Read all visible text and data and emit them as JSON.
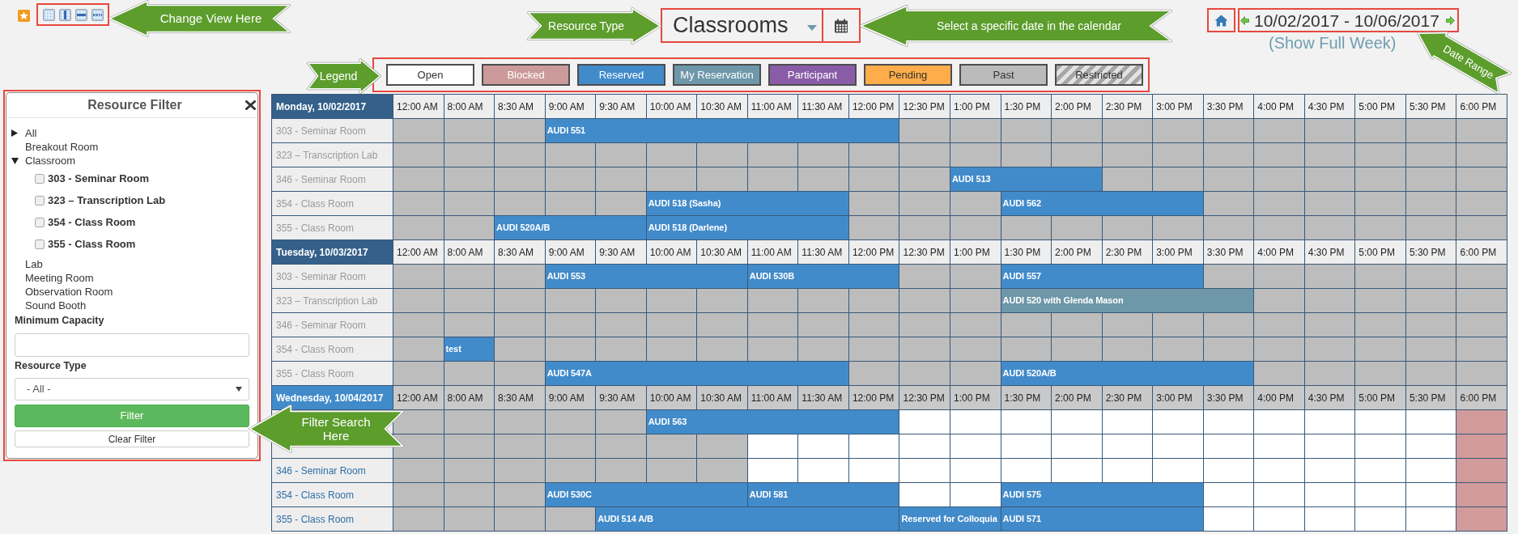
{
  "callouts": {
    "change_view": "Change View Here",
    "resource_type": "Resource Type",
    "select_date": "Select a specific date in the calendar",
    "date_range": "Date Range",
    "legend": "Legend",
    "filter_search": "Filter Search Here"
  },
  "resource_type": {
    "value": "Classrooms"
  },
  "date_range": {
    "text": "10/02/2017 - 10/06/2017",
    "link": "(Show Full Week)"
  },
  "legend": [
    {
      "label": "Open",
      "color": "#ffffff",
      "striped": false
    },
    {
      "label": "Blocked",
      "color": "#cc9a9a",
      "striped": false
    },
    {
      "label": "Reserved",
      "color": "#428bca",
      "striped": false
    },
    {
      "label": "My Reservation",
      "color": "#6e98aa",
      "striped": false
    },
    {
      "label": "Participant",
      "color": "#8a5ca8",
      "striped": false
    },
    {
      "label": "Pending",
      "color": "#ffad4a",
      "striped": false
    },
    {
      "label": "Past",
      "color": "#bbbbbb",
      "striped": false
    },
    {
      "label": "Restricted",
      "color": "#a6a6a6",
      "striped": true
    }
  ],
  "filter_panel": {
    "title": "Resource Filter",
    "tree": [
      {
        "label": "All",
        "expanded": false
      },
      {
        "label": "Breakout Room"
      },
      {
        "label": "Classroom",
        "expanded": true,
        "children": [
          {
            "label": "303 - Seminar Room",
            "checked": false
          },
          {
            "label": "323 – Transcription Lab",
            "checked": false
          },
          {
            "label": "354 - Class Room",
            "checked": false
          },
          {
            "label": "355 - Class Room",
            "checked": false
          }
        ]
      },
      {
        "label": "Lab"
      },
      {
        "label": "Meeting Room"
      },
      {
        "label": "Observation Room"
      },
      {
        "label": "Sound Booth"
      }
    ],
    "capacity": {
      "label": "Minimum Capacity"
    },
    "type_filter": {
      "label": "Resource Type",
      "value": "- All -"
    },
    "buttons": [
      {
        "label": "Filter",
        "kind": "primary"
      },
      {
        "label": "Clear Filter",
        "kind": "secondary"
      }
    ]
  },
  "schedule": {
    "days": [
      {
        "label": "Monday, 10/02/2017",
        "past": true,
        "times": [
          "12:00 AM",
          "8:00 AM",
          "8:30 AM",
          "9:00 AM",
          "9:30 AM",
          "10:00 AM",
          "10:30 AM",
          "11:00 AM",
          "11:30 AM",
          "12:00 PM",
          "12:30 PM",
          "1:00 PM",
          "1:30 PM",
          "2:00 PM",
          "2:30 PM",
          "3:00 PM",
          "3:30 PM",
          "4:00 PM",
          "4:30 PM",
          "5:00 PM",
          "5:30 PM",
          "6:00 PM"
        ],
        "rows": [
          {
            "room": "303 - Seminar Room",
            "cells": [
              {
                "kind": "slot",
                "color": "#bdbdbd"
              },
              {
                "kind": "slot",
                "color": "#bdbdbd"
              },
              {
                "kind": "slot",
                "color": "#bdbdbd"
              },
              {
                "kind": "booking",
                "color": "#428bca",
                "label": "AUDI 551"
              },
              {
                "kind": "continued"
              },
              {
                "kind": "continued"
              },
              {
                "kind": "continued"
              },
              {
                "kind": "continued"
              },
              {
                "kind": "continued"
              },
              {
                "kind": "continued"
              },
              {
                "kind": "slot",
                "color": "#bdbdbd"
              },
              {
                "kind": "slot",
                "color": "#bdbdbd"
              },
              {
                "kind": "slot",
                "color": "#bdbdbd"
              },
              {
                "kind": "slot",
                "color": "#bdbdbd"
              },
              {
                "kind": "slot",
                "color": "#bdbdbd"
              },
              {
                "kind": "slot",
                "color": "#bdbdbd"
              },
              {
                "kind": "slot",
                "color": "#bdbdbd"
              },
              {
                "kind": "slot",
                "color": "#bdbdbd"
              },
              {
                "kind": "slot",
                "color": "#bdbdbd"
              },
              {
                "kind": "slot",
                "color": "#bdbdbd"
              },
              {
                "kind": "slot",
                "color": "#bdbdbd"
              },
              {
                "kind": "slot",
                "color": "#bdbdbd"
              }
            ]
          },
          {
            "room": "323 – Transcription Lab",
            "cells": [
              {
                "kind": "slot",
                "color": "#bdbdbd"
              },
              {
                "kind": "slot",
                "color": "#bdbdbd"
              },
              {
                "kind": "slot",
                "color": "#bdbdbd"
              },
              {
                "kind": "slot",
                "color": "#bdbdbd"
              },
              {
                "kind": "slot",
                "color": "#bdbdbd"
              },
              {
                "kind": "slot",
                "color": "#bdbdbd"
              },
              {
                "kind": "slot",
                "color": "#bdbdbd"
              },
              {
                "kind": "slot",
                "color": "#bdbdbd"
              },
              {
                "kind": "slot",
                "color": "#bdbdbd"
              },
              {
                "kind": "slot",
                "color": "#bdbdbd"
              },
              {
                "kind": "slot",
                "color": "#bdbdbd"
              },
              {
                "kind": "slot",
                "color": "#bdbdbd"
              },
              {
                "kind": "slot",
                "color": "#bdbdbd"
              },
              {
                "kind": "slot",
                "color": "#bdbdbd"
              },
              {
                "kind": "slot",
                "color": "#bdbdbd"
              },
              {
                "kind": "slot",
                "color": "#bdbdbd"
              },
              {
                "kind": "slot",
                "color": "#bdbdbd"
              },
              {
                "kind": "slot",
                "color": "#bdbdbd"
              },
              {
                "kind": "slot",
                "color": "#bdbdbd"
              },
              {
                "kind": "slot",
                "color": "#bdbdbd"
              },
              {
                "kind": "slot",
                "color": "#bdbdbd"
              },
              {
                "kind": "slot",
                "color": "#bdbdbd"
              }
            ]
          },
          {
            "room": "346 - Seminar Room",
            "cells": [
              {
                "kind": "slot",
                "color": "#bdbdbd"
              },
              {
                "kind": "slot",
                "color": "#bdbdbd"
              },
              {
                "kind": "slot",
                "color": "#bdbdbd"
              },
              {
                "kind": "slot",
                "color": "#bdbdbd"
              },
              {
                "kind": "slot",
                "color": "#bdbdbd"
              },
              {
                "kind": "slot",
                "color": "#bdbdbd"
              },
              {
                "kind": "slot",
                "color": "#bdbdbd"
              },
              {
                "kind": "slot",
                "color": "#bdbdbd"
              },
              {
                "kind": "slot",
                "color": "#bdbdbd"
              },
              {
                "kind": "slot",
                "color": "#bdbdbd"
              },
              {
                "kind": "slot",
                "color": "#bdbdbd"
              },
              {
                "kind": "booking",
                "color": "#428bca",
                "label": "AUDI 513"
              },
              {
                "kind": "continued"
              },
              {
                "kind": "continued"
              },
              {
                "kind": "slot",
                "color": "#bdbdbd"
              },
              {
                "kind": "slot",
                "color": "#bdbdbd"
              },
              {
                "kind": "slot",
                "color": "#bdbdbd"
              },
              {
                "kind": "slot",
                "color": "#bdbdbd"
              },
              {
                "kind": "slot",
                "color": "#bdbdbd"
              },
              {
                "kind": "slot",
                "color": "#bdbdbd"
              },
              {
                "kind": "slot",
                "color": "#bdbdbd"
              },
              {
                "kind": "slot",
                "color": "#bdbdbd"
              }
            ]
          },
          {
            "room": "354 - Class Room",
            "cells": [
              {
                "kind": "slot",
                "color": "#bdbdbd"
              },
              {
                "kind": "slot",
                "color": "#bdbdbd"
              },
              {
                "kind": "slot",
                "color": "#bdbdbd"
              },
              {
                "kind": "slot",
                "color": "#bdbdbd"
              },
              {
                "kind": "slot",
                "color": "#bdbdbd"
              },
              {
                "kind": "booking",
                "color": "#428bca",
                "label": "AUDI 518 (Sasha)"
              },
              {
                "kind": "continued"
              },
              {
                "kind": "continued"
              },
              {
                "kind": "continued"
              },
              {
                "kind": "slot",
                "color": "#bdbdbd"
              },
              {
                "kind": "slot",
                "color": "#bdbdbd"
              },
              {
                "kind": "slot",
                "color": "#bdbdbd"
              },
              {
                "kind": "booking",
                "color": "#428bca",
                "label": "AUDI 562"
              },
              {
                "kind": "continued"
              },
              {
                "kind": "continued"
              },
              {
                "kind": "continued"
              },
              {
                "kind": "slot",
                "color": "#bdbdbd"
              },
              {
                "kind": "slot",
                "color": "#bdbdbd"
              },
              {
                "kind": "slot",
                "color": "#bdbdbd"
              },
              {
                "kind": "slot",
                "color": "#bdbdbd"
              },
              {
                "kind": "slot",
                "color": "#bdbdbd"
              },
              {
                "kind": "slot",
                "color": "#bdbdbd"
              }
            ]
          },
          {
            "room": "355 - Class Room",
            "cells": [
              {
                "kind": "slot",
                "color": "#bdbdbd"
              },
              {
                "kind": "slot",
                "color": "#bdbdbd"
              },
              {
                "kind": "booking",
                "color": "#428bca",
                "label": "AUDI 520A/B"
              },
              {
                "kind": "continued"
              },
              {
                "kind": "continued"
              },
              {
                "kind": "booking",
                "color": "#428bca",
                "label": "AUDI 518 (Darlene)"
              },
              {
                "kind": "continued"
              },
              {
                "kind": "continued"
              },
              {
                "kind": "continued"
              },
              {
                "kind": "slot",
                "color": "#bdbdbd"
              },
              {
                "kind": "slot",
                "color": "#bdbdbd"
              },
              {
                "kind": "slot",
                "color": "#bdbdbd"
              },
              {
                "kind": "slot",
                "color": "#bdbdbd"
              },
              {
                "kind": "slot",
                "color": "#bdbdbd"
              },
              {
                "kind": "slot",
                "color": "#bdbdbd"
              },
              {
                "kind": "slot",
                "color": "#bdbdbd"
              },
              {
                "kind": "slot",
                "color": "#bdbdbd"
              },
              {
                "kind": "slot",
                "color": "#bdbdbd"
              },
              {
                "kind": "slot",
                "color": "#bdbdbd"
              },
              {
                "kind": "slot",
                "color": "#bdbdbd"
              },
              {
                "kind": "slot",
                "color": "#bdbdbd"
              },
              {
                "kind": "slot",
                "color": "#bdbdbd"
              }
            ]
          }
        ]
      },
      {
        "label": "Tuesday, 10/03/2017",
        "past": true,
        "times": [
          "12:00 AM",
          "8:00 AM",
          "8:30 AM",
          "9:00 AM",
          "9:30 AM",
          "10:00 AM",
          "10:30 AM",
          "11:00 AM",
          "11:30 AM",
          "12:00 PM",
          "12:30 PM",
          "1:00 PM",
          "1:30 PM",
          "2:00 PM",
          "2:30 PM",
          "3:00 PM",
          "3:30 PM",
          "4:00 PM",
          "4:30 PM",
          "5:00 PM",
          "5:30 PM",
          "6:00 PM"
        ],
        "rows": [
          {
            "room": "303 - Seminar Room",
            "cells": [
              {
                "kind": "slot",
                "color": "#bdbdbd"
              },
              {
                "kind": "slot",
                "color": "#bdbdbd"
              },
              {
                "kind": "slot",
                "color": "#bdbdbd"
              },
              {
                "kind": "booking",
                "color": "#428bca",
                "label": "AUDI 553"
              },
              {
                "kind": "continued"
              },
              {
                "kind": "continued"
              },
              {
                "kind": "continued"
              },
              {
                "kind": "booking",
                "color": "#428bca",
                "label": "AUDI 530B"
              },
              {
                "kind": "continued"
              },
              {
                "kind": "continued"
              },
              {
                "kind": "slot",
                "color": "#bdbdbd"
              },
              {
                "kind": "slot",
                "color": "#bdbdbd"
              },
              {
                "kind": "booking",
                "color": "#428bca",
                "label": "AUDI 557"
              },
              {
                "kind": "continued"
              },
              {
                "kind": "continued"
              },
              {
                "kind": "continued"
              },
              {
                "kind": "slot",
                "color": "#bdbdbd"
              },
              {
                "kind": "slot",
                "color": "#bdbdbd"
              },
              {
                "kind": "slot",
                "color": "#bdbdbd"
              },
              {
                "kind": "slot",
                "color": "#bdbdbd"
              },
              {
                "kind": "slot",
                "color": "#bdbdbd"
              },
              {
                "kind": "slot",
                "color": "#bdbdbd"
              }
            ]
          },
          {
            "room": "323 – Transcription Lab",
            "cells": [
              {
                "kind": "slot",
                "color": "#bdbdbd"
              },
              {
                "kind": "slot",
                "color": "#bdbdbd"
              },
              {
                "kind": "slot",
                "color": "#bdbdbd"
              },
              {
                "kind": "slot",
                "color": "#bdbdbd"
              },
              {
                "kind": "slot",
                "color": "#bdbdbd"
              },
              {
                "kind": "slot",
                "color": "#bdbdbd"
              },
              {
                "kind": "slot",
                "color": "#bdbdbd"
              },
              {
                "kind": "slot",
                "color": "#bdbdbd"
              },
              {
                "kind": "slot",
                "color": "#bdbdbd"
              },
              {
                "kind": "slot",
                "color": "#bdbdbd"
              },
              {
                "kind": "slot",
                "color": "#bdbdbd"
              },
              {
                "kind": "slot",
                "color": "#bdbdbd"
              },
              {
                "kind": "booking",
                "color": "#6e97a9",
                "label": "AUDI 520 with Glenda Mason"
              },
              {
                "kind": "continued"
              },
              {
                "kind": "continued"
              },
              {
                "kind": "continued"
              },
              {
                "kind": "continued"
              },
              {
                "kind": "slot",
                "color": "#bdbdbd"
              },
              {
                "kind": "slot",
                "color": "#bdbdbd"
              },
              {
                "kind": "slot",
                "color": "#bdbdbd"
              },
              {
                "kind": "slot",
                "color": "#bdbdbd"
              },
              {
                "kind": "slot",
                "color": "#bdbdbd"
              }
            ]
          },
          {
            "room": "346 - Seminar Room",
            "cells": [
              {
                "kind": "slot",
                "color": "#bdbdbd"
              },
              {
                "kind": "slot",
                "color": "#bdbdbd"
              },
              {
                "kind": "slot",
                "color": "#bdbdbd"
              },
              {
                "kind": "slot",
                "color": "#bdbdbd"
              },
              {
                "kind": "slot",
                "color": "#bdbdbd"
              },
              {
                "kind": "slot",
                "color": "#bdbdbd"
              },
              {
                "kind": "slot",
                "color": "#bdbdbd"
              },
              {
                "kind": "slot",
                "color": "#bdbdbd"
              },
              {
                "kind": "slot",
                "color": "#bdbdbd"
              },
              {
                "kind": "slot",
                "color": "#bdbdbd"
              },
              {
                "kind": "slot",
                "color": "#bdbdbd"
              },
              {
                "kind": "slot",
                "color": "#bdbdbd"
              },
              {
                "kind": "slot",
                "color": "#bdbdbd"
              },
              {
                "kind": "slot",
                "color": "#bdbdbd"
              },
              {
                "kind": "slot",
                "color": "#bdbdbd"
              },
              {
                "kind": "slot",
                "color": "#bdbdbd"
              },
              {
                "kind": "slot",
                "color": "#bdbdbd"
              },
              {
                "kind": "slot",
                "color": "#bdbdbd"
              },
              {
                "kind": "slot",
                "color": "#bdbdbd"
              },
              {
                "kind": "slot",
                "color": "#bdbdbd"
              },
              {
                "kind": "slot",
                "color": "#bdbdbd"
              },
              {
                "kind": "slot",
                "color": "#bdbdbd"
              }
            ]
          },
          {
            "room": "354 - Class Room",
            "cells": [
              {
                "kind": "slot",
                "color": "#bdbdbd"
              },
              {
                "kind": "booking",
                "color": "#428bca",
                "label": "test"
              },
              {
                "kind": "slot",
                "color": "#bdbdbd"
              },
              {
                "kind": "slot",
                "color": "#bdbdbd"
              },
              {
                "kind": "slot",
                "color": "#bdbdbd"
              },
              {
                "kind": "slot",
                "color": "#bdbdbd"
              },
              {
                "kind": "slot",
                "color": "#bdbdbd"
              },
              {
                "kind": "slot",
                "color": "#bdbdbd"
              },
              {
                "kind": "slot",
                "color": "#bdbdbd"
              },
              {
                "kind": "slot",
                "color": "#bdbdbd"
              },
              {
                "kind": "slot",
                "color": "#bdbdbd"
              },
              {
                "kind": "slot",
                "color": "#bdbdbd"
              },
              {
                "kind": "slot",
                "color": "#bdbdbd"
              },
              {
                "kind": "slot",
                "color": "#bdbdbd"
              },
              {
                "kind": "slot",
                "color": "#bdbdbd"
              },
              {
                "kind": "slot",
                "color": "#bdbdbd"
              },
              {
                "kind": "slot",
                "color": "#bdbdbd"
              },
              {
                "kind": "slot",
                "color": "#bdbdbd"
              },
              {
                "kind": "slot",
                "color": "#bdbdbd"
              },
              {
                "kind": "slot",
                "color": "#bdbdbd"
              },
              {
                "kind": "slot",
                "color": "#bdbdbd"
              },
              {
                "kind": "slot",
                "color": "#bdbdbd"
              }
            ]
          },
          {
            "room": "355 - Class Room",
            "cells": [
              {
                "kind": "slot",
                "color": "#bdbdbd"
              },
              {
                "kind": "slot",
                "color": "#bdbdbd"
              },
              {
                "kind": "slot",
                "color": "#bdbdbd"
              },
              {
                "kind": "booking",
                "color": "#428bca",
                "label": "AUDI 547A"
              },
              {
                "kind": "continued"
              },
              {
                "kind": "continued"
              },
              {
                "kind": "continued"
              },
              {
                "kind": "continued"
              },
              {
                "kind": "continued"
              },
              {
                "kind": "slot",
                "color": "#bdbdbd"
              },
              {
                "kind": "slot",
                "color": "#bdbdbd"
              },
              {
                "kind": "slot",
                "color": "#bdbdbd"
              },
              {
                "kind": "booking",
                "color": "#428bca",
                "label": "AUDI 520A/B"
              },
              {
                "kind": "continued"
              },
              {
                "kind": "continued"
              },
              {
                "kind": "continued"
              },
              {
                "kind": "continued"
              },
              {
                "kind": "slot",
                "color": "#bdbdbd"
              },
              {
                "kind": "slot",
                "color": "#bdbdbd"
              },
              {
                "kind": "slot",
                "color": "#bdbdbd"
              },
              {
                "kind": "slot",
                "color": "#bdbdbd"
              },
              {
                "kind": "slot",
                "color": "#bdbdbd"
              }
            ]
          }
        ]
      },
      {
        "label": "Wednesday, 10/04/2017",
        "past": false,
        "times": [
          "12:00 AM",
          "8:00 AM",
          "8:30 AM",
          "9:00 AM",
          "9:30 AM",
          "10:00 AM",
          "10:30 AM",
          "11:00 AM",
          "11:30 AM",
          "12:00 PM",
          "12:30 PM",
          "1:00 PM",
          "1:30 PM",
          "2:00 PM",
          "2:30 PM",
          "3:00 PM",
          "3:30 PM",
          "4:00 PM",
          "4:30 PM",
          "5:00 PM",
          "5:30 PM",
          "6:00 PM"
        ],
        "rows": [
          {
            "cells": [
              {
                "kind": "slot",
                "color": "#bdbdbd"
              },
              {
                "kind": "slot",
                "color": "#bdbdbd"
              },
              {
                "kind": "slot",
                "color": "#bdbdbd"
              },
              {
                "kind": "slot",
                "color": "#bdbdbd"
              },
              {
                "kind": "slot",
                "color": "#bdbdbd"
              },
              {
                "kind": "booking",
                "color": "#428bca",
                "label": "AUDI 563"
              },
              {
                "kind": "continued"
              },
              {
                "kind": "continued"
              },
              {
                "kind": "continued"
              },
              {
                "kind": "continued"
              },
              {
                "kind": "slot",
                "color": "#ffffff"
              },
              {
                "kind": "slot",
                "color": "#ffffff"
              },
              {
                "kind": "slot",
                "color": "#ffffff"
              },
              {
                "kind": "slot",
                "color": "#ffffff"
              },
              {
                "kind": "slot",
                "color": "#ffffff"
              },
              {
                "kind": "slot",
                "color": "#ffffff"
              },
              {
                "kind": "slot",
                "color": "#ffffff"
              },
              {
                "kind": "slot",
                "color": "#ffffff"
              },
              {
                "kind": "slot",
                "color": "#ffffff"
              },
              {
                "kind": "slot",
                "color": "#ffffff"
              },
              {
                "kind": "slot",
                "color": "#ffffff"
              },
              {
                "kind": "slot",
                "color": "#d19b9b"
              }
            ]
          },
          {
            "cells": [
              {
                "kind": "slot",
                "color": "#bdbdbd"
              },
              {
                "kind": "slot",
                "color": "#bdbdbd"
              },
              {
                "kind": "slot",
                "color": "#bdbdbd"
              },
              {
                "kind": "slot",
                "color": "#bdbdbd"
              },
              {
                "kind": "slot",
                "color": "#bdbdbd"
              },
              {
                "kind": "slot",
                "color": "#bdbdbd"
              },
              {
                "kind": "slot",
                "color": "#bdbdbd"
              },
              {
                "kind": "slot",
                "color": "#ffffff"
              },
              {
                "kind": "slot",
                "color": "#ffffff"
              },
              {
                "kind": "slot",
                "color": "#ffffff"
              },
              {
                "kind": "slot",
                "color": "#ffffff"
              },
              {
                "kind": "slot",
                "color": "#ffffff"
              },
              {
                "kind": "slot",
                "color": "#ffffff"
              },
              {
                "kind": "slot",
                "color": "#ffffff"
              },
              {
                "kind": "slot",
                "color": "#ffffff"
              },
              {
                "kind": "slot",
                "color": "#ffffff"
              },
              {
                "kind": "slot",
                "color": "#ffffff"
              },
              {
                "kind": "slot",
                "color": "#ffffff"
              },
              {
                "kind": "slot",
                "color": "#ffffff"
              },
              {
                "kind": "slot",
                "color": "#ffffff"
              },
              {
                "kind": "slot",
                "color": "#ffffff"
              },
              {
                "kind": "slot",
                "color": "#d19b9b"
              }
            ]
          },
          {
            "room": "346 - Seminar Room",
            "cells": [
              {
                "kind": "slot",
                "color": "#bdbdbd"
              },
              {
                "kind": "slot",
                "color": "#bdbdbd"
              },
              {
                "kind": "slot",
                "color": "#bdbdbd"
              },
              {
                "kind": "slot",
                "color": "#bdbdbd"
              },
              {
                "kind": "slot",
                "color": "#bdbdbd"
              },
              {
                "kind": "slot",
                "color": "#bdbdbd"
              },
              {
                "kind": "slot",
                "color": "#bdbdbd"
              },
              {
                "kind": "slot",
                "color": "#ffffff"
              },
              {
                "kind": "slot",
                "color": "#ffffff"
              },
              {
                "kind": "slot",
                "color": "#ffffff"
              },
              {
                "kind": "slot",
                "color": "#ffffff"
              },
              {
                "kind": "slot",
                "color": "#ffffff"
              },
              {
                "kind": "slot",
                "color": "#ffffff"
              },
              {
                "kind": "slot",
                "color": "#ffffff"
              },
              {
                "kind": "slot",
                "color": "#ffffff"
              },
              {
                "kind": "slot",
                "color": "#ffffff"
              },
              {
                "kind": "slot",
                "color": "#ffffff"
              },
              {
                "kind": "slot",
                "color": "#ffffff"
              },
              {
                "kind": "slot",
                "color": "#ffffff"
              },
              {
                "kind": "slot",
                "color": "#ffffff"
              },
              {
                "kind": "slot",
                "color": "#ffffff"
              },
              {
                "kind": "slot",
                "color": "#d19b9b"
              }
            ]
          },
          {
            "room": "354 - Class Room",
            "cells": [
              {
                "kind": "slot",
                "color": "#bdbdbd"
              },
              {
                "kind": "slot",
                "color": "#bdbdbd"
              },
              {
                "kind": "slot",
                "color": "#bdbdbd"
              },
              {
                "kind": "booking",
                "color": "#428bca",
                "label": "AUDI 530C"
              },
              {
                "kind": "continued"
              },
              {
                "kind": "continued"
              },
              {
                "kind": "continued"
              },
              {
                "kind": "booking",
                "color": "#428bca",
                "label": "AUDI 581"
              },
              {
                "kind": "continued"
              },
              {
                "kind": "continued"
              },
              {
                "kind": "slot",
                "color": "#ffffff"
              },
              {
                "kind": "slot",
                "color": "#ffffff"
              },
              {
                "kind": "booking",
                "color": "#428bca",
                "label": "AUDI 575"
              },
              {
                "kind": "continued"
              },
              {
                "kind": "continued"
              },
              {
                "kind": "continued"
              },
              {
                "kind": "slot",
                "color": "#ffffff"
              },
              {
                "kind": "slot",
                "color": "#ffffff"
              },
              {
                "kind": "slot",
                "color": "#ffffff"
              },
              {
                "kind": "slot",
                "color": "#ffffff"
              },
              {
                "kind": "slot",
                "color": "#ffffff"
              },
              {
                "kind": "slot",
                "color": "#d19b9b"
              }
            ]
          },
          {
            "room": "355 - Class Room",
            "cells": [
              {
                "kind": "slot",
                "color": "#bdbdbd"
              },
              {
                "kind": "slot",
                "color": "#bdbdbd"
              },
              {
                "kind": "slot",
                "color": "#bdbdbd"
              },
              {
                "kind": "slot",
                "color": "#bdbdbd"
              },
              {
                "kind": "booking",
                "color": "#428bca",
                "label": "AUDI 514 A/B"
              },
              {
                "kind": "continued"
              },
              {
                "kind": "continued"
              },
              {
                "kind": "continued"
              },
              {
                "kind": "continued"
              },
              {
                "kind": "continued"
              },
              {
                "kind": "booking",
                "color": "#428bca",
                "label": "Reserved for Colloquia"
              },
              {
                "kind": "continued"
              },
              {
                "kind": "booking",
                "color": "#428bca",
                "label": "AUDI 571"
              },
              {
                "kind": "continued"
              },
              {
                "kind": "continued"
              },
              {
                "kind": "continued"
              },
              {
                "kind": "slot",
                "color": "#ffffff"
              },
              {
                "kind": "slot",
                "color": "#ffffff"
              },
              {
                "kind": "slot",
                "color": "#ffffff"
              },
              {
                "kind": "slot",
                "color": "#ffffff"
              },
              {
                "kind": "slot",
                "color": "#ffffff"
              },
              {
                "kind": "slot",
                "color": "#d19b9b"
              }
            ]
          }
        ]
      }
    ]
  }
}
